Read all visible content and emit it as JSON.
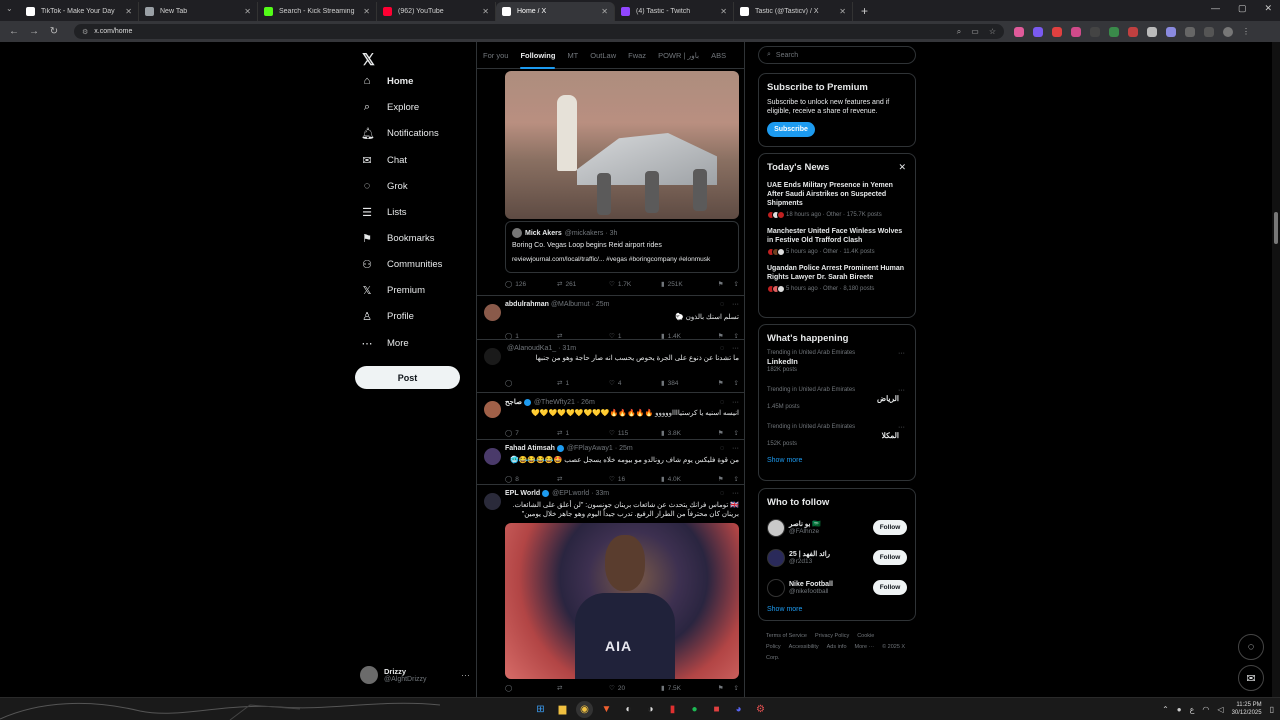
{
  "browser": {
    "tabs": [
      {
        "title": "TikTok - Make Your Day",
        "icon": "tiktok-icon",
        "color": "#ffffff"
      },
      {
        "title": "New Tab",
        "icon": "globe-icon",
        "color": "#9aa0a6"
      },
      {
        "title": "Search - Kick Streaming",
        "icon": "kick-icon",
        "color": "#53fc18"
      },
      {
        "title": "(962) YouTube",
        "icon": "youtube-icon",
        "color": "#ff0033"
      },
      {
        "title": "Home / X",
        "icon": "x-icon",
        "color": "#ffffff",
        "active": true
      },
      {
        "title": "(4) Tastic - Twitch",
        "icon": "twitch-icon",
        "color": "#9146ff"
      },
      {
        "title": "Tastic (@Tasticv) / X",
        "icon": "x-icon",
        "color": "#ffffff"
      }
    ],
    "url": "x.com/home"
  },
  "nav": {
    "items": [
      {
        "label": "Home",
        "icon": "home-icon",
        "glyph": "⌂",
        "active": true
      },
      {
        "label": "Explore",
        "icon": "search-icon",
        "glyph": "⌕"
      },
      {
        "label": "Notifications",
        "icon": "bell-icon",
        "glyph": "🔔︎"
      },
      {
        "label": "Chat",
        "icon": "chat-icon",
        "glyph": "✉"
      },
      {
        "label": "Grok",
        "icon": "grok-icon",
        "glyph": "◌"
      },
      {
        "label": "Lists",
        "icon": "list-icon",
        "glyph": "☰"
      },
      {
        "label": "Bookmarks",
        "icon": "bookmark-icon",
        "glyph": "⚑"
      },
      {
        "label": "Communities",
        "icon": "communities-icon",
        "glyph": "⚇"
      },
      {
        "label": "Premium",
        "icon": "x-icon",
        "glyph": "𝕏"
      },
      {
        "label": "Profile",
        "icon": "profile-icon",
        "glyph": "♙"
      },
      {
        "label": "More",
        "icon": "more-circle-icon",
        "glyph": "⋯"
      }
    ],
    "post_label": "Post",
    "account": {
      "name": "Drizzy",
      "handle": "@AlghtDrizzy"
    }
  },
  "feed": {
    "tabs": [
      "For you",
      "Following",
      "MT",
      "OutLaw",
      "Fwaz",
      "POWR | باور",
      "ABS"
    ],
    "active_tab": "Following",
    "quote_card": {
      "author": "Mick Akers",
      "handle": "@mickakers",
      "time": "· 3h",
      "text": "Boring Co. Vegas Loop begins Reid airport rides",
      "url": "reviewjournal.com/local/traffic/... #vegas #boringcompany #elonmusk"
    },
    "first_actions": {
      "replies": "126",
      "reposts": "261",
      "likes": "1.7K",
      "views": "251K"
    },
    "tweets": [
      {
        "name": "abdulrahman",
        "handle": "@MAlbumut",
        "time": "· 25m",
        "text": "تسلم اسنك بالذون 🐑",
        "replies": "1",
        "reposts": "",
        "likes": "1",
        "views": "1.4K",
        "avatar": "#8a5a4a",
        "verified": false
      },
      {
        "name": "",
        "handle": "@AlanoudKa1_",
        "time": "· 31m",
        "text": "ما تشدنا عن ذنوع على الجرة يحوص يحسب انه صار حاجة وهو من جنبها",
        "replies": "",
        "reposts": "1",
        "likes": "4",
        "views": "384",
        "avatar": "#1a1a1a",
        "verified": false
      },
      {
        "name": "صاجح",
        "handle": "@TheWfty21",
        "time": "· 26m",
        "text": "انيسه اسنيه يا كرستيااااووووو 🔥🔥🔥🔥🔥💛💛💛💛💛💛💛💛💛",
        "replies": "7",
        "reposts": "1",
        "likes": "115",
        "views": "3.8K",
        "avatar": "#a06048",
        "verified": true
      },
      {
        "name": "Fahad Atimsah",
        "handle": "@FPlayAway1",
        "time": "· 25m",
        "text": "من قوة فليكس يوم شاف رونالدو مو بيومه خلاه يسجل عصب 🤩😂😂😂😂🥶",
        "replies": "8",
        "reposts": "",
        "likes": "16",
        "views": "4.0K",
        "avatar": "#4a3a6a",
        "verified": true
      },
      {
        "name": "EPL World",
        "handle": "@EPLworld",
        "time": "· 33m",
        "text": "🇬🇧 توماس فرانك يتحدث عن شائعات برينان جونسون: \"لن أعلق على الشائعات. برينان كان محترفاً من الطراز الرفيع. تدرب جيداً اليوم وهو جاهز خلال يومين\"",
        "replies": "",
        "reposts": "",
        "likes": "20",
        "views": "7.5K",
        "avatar": "#2a2a3a",
        "verified": true
      }
    ]
  },
  "sidebar": {
    "search_placeholder": "Search",
    "premium": {
      "title": "Subscribe to Premium",
      "text": "Subscribe to unlock new features and if eligible, receive a share of revenue.",
      "button": "Subscribe"
    },
    "news": {
      "title": "Today's News",
      "items": [
        {
          "title": "UAE Ends Military Presence in Yemen After Saudi Airstrikes on Suspected Shipments",
          "meta": "18 hours ago · Other · 175.7K posts"
        },
        {
          "title": "Manchester United Face Winless Wolves in Festive Old Trafford Clash",
          "meta": "5 hours ago · Other · 11.4K posts"
        },
        {
          "title": "Ugandan Police Arrest Prominent Human Rights Lawyer Dr. Sarah Bireete",
          "meta": "5 hours ago · Other · 8,180 posts"
        }
      ]
    },
    "happening": {
      "title": "What's happening",
      "trends": [
        {
          "context": "Trending in United Arab Emirates",
          "name": "LinkedIn",
          "posts": "182K posts",
          "rtl": false
        },
        {
          "context": "Trending in United Arab Emirates",
          "name": "الرياض",
          "posts": "1.45M posts",
          "rtl": true
        },
        {
          "context": "Trending in United Arab Emirates",
          "name": "المكلا",
          "posts": "152K posts",
          "rtl": true
        }
      ],
      "show_more": "Show more"
    },
    "who_to_follow": {
      "title": "Who to follow",
      "accounts": [
        {
          "name": "بو ناصر 🇸🇦",
          "handle": "@FAlhnze",
          "button": "Follow",
          "avatar": "#c9c9c9"
        },
        {
          "name": "25 | رائد الفهد",
          "handle": "@r2d13",
          "button": "Follow",
          "avatar": "#2a2a5a"
        },
        {
          "name": "Nike Football",
          "handle": "@nikefootball",
          "button": "Follow",
          "avatar": "#000000"
        }
      ],
      "show_more": "Show more"
    },
    "footer": [
      "Terms of Service",
      "Privacy Policy",
      "Cookie Policy",
      "Accessibility",
      "Ads info",
      "More ···",
      "© 2025 X Corp."
    ]
  },
  "taskbar": {
    "time": "11:25 PM",
    "date": "30/12/2025",
    "lang": "ع"
  },
  "colors": {
    "accent": "#1d9bf0",
    "background": "#000000",
    "text": "#e7e9ea",
    "muted": "#71767b"
  }
}
